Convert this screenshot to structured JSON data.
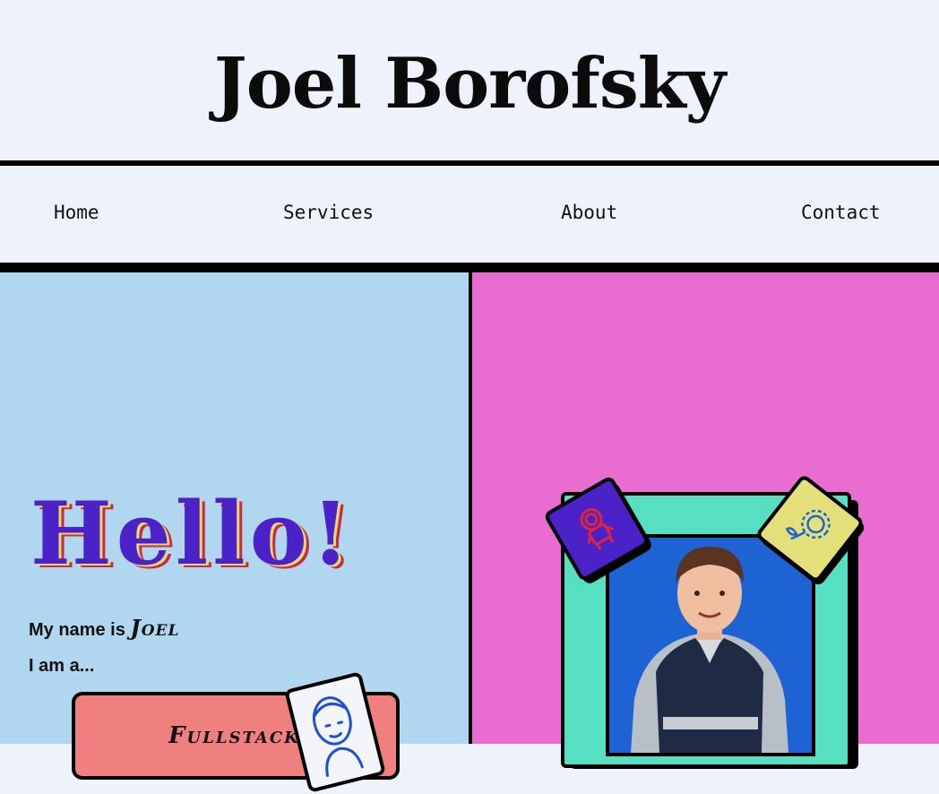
{
  "header": {
    "title": "Joel Borofsky"
  },
  "nav": {
    "items": [
      "Home",
      "Services",
      "About",
      "Contact"
    ]
  },
  "hero": {
    "greeting": "Hello!",
    "intro_prefix": "My name is ",
    "name": "Joel",
    "role_prompt": "I am a...",
    "role": "Fullstack"
  },
  "colors": {
    "background": "#eef2fb",
    "left_panel": "#b1d6f0",
    "right_panel": "#e96dd1",
    "greeting": "#4a22c8",
    "frame": "#56dfc0",
    "photo_bg": "#1e63d4",
    "role_card": "#f08080",
    "astronaut_tile": "#4a22c8",
    "sunflower_tile": "#e3e07a"
  },
  "icons": [
    "astronaut-icon",
    "sunflower-icon",
    "developer-portrait-icon"
  ]
}
